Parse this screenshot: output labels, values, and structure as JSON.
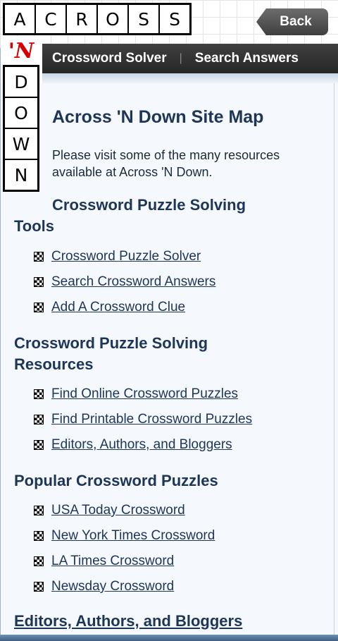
{
  "logo": {
    "across": [
      "A",
      "C",
      "R",
      "O",
      "S",
      "S"
    ],
    "n": "'N",
    "down": [
      "D",
      "O",
      "W",
      "N"
    ]
  },
  "header": {
    "back_label": "Back",
    "nav": [
      "Crossword Solver",
      "Search Answers"
    ],
    "nav_separator": "|"
  },
  "page": {
    "title": "Across 'N Down Site Map",
    "intro": "Please visit some of the many resources available at Across 'N Down."
  },
  "sections": [
    {
      "title": "Crossword Puzzle Solving Tools",
      "links": [
        "Crossword Puzzle Solver",
        "Search Crossword Answers",
        "Add A Crossword Clue"
      ]
    },
    {
      "title": "Crossword Puzzle Solving Resources",
      "links": [
        "Find Online Crossword Puzzles",
        "Find Printable Crossword Puzzles",
        "Editors, Authors, and Bloggers"
      ]
    },
    {
      "title": "Popular Crossword Puzzles",
      "links": [
        "USA Today Crossword",
        "New York Times Crossword",
        "LA Times Crossword",
        "Newsday Crossword"
      ]
    }
  ],
  "bottom_link": "Editors, Authors, and Bloggers",
  "colors": {
    "heading": "#1d3557",
    "logo_red": "#d60000",
    "navbar": "#333333"
  }
}
